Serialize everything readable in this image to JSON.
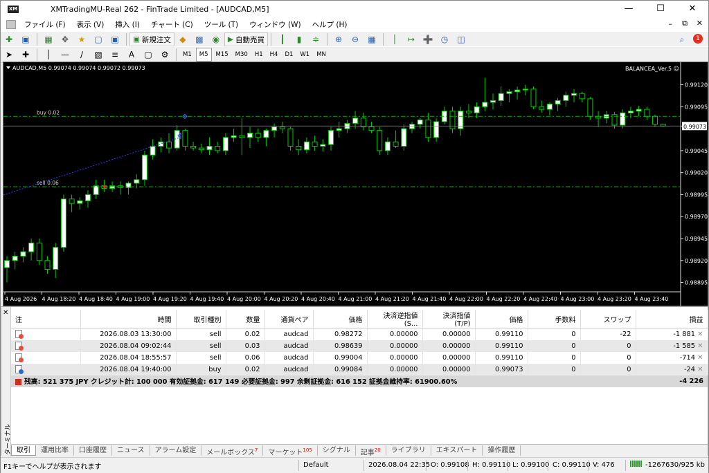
{
  "window": {
    "title": "XMTradingMU-Real 262 - FinTrade Limited - [AUDCAD,M5]",
    "icon_text": "XM"
  },
  "menu": [
    "ファイル (F)",
    "表示 (V)",
    "挿入 (I)",
    "チャート (C)",
    "ツール (T)",
    "ウィンドウ (W)",
    "ヘルプ (H)"
  ],
  "toolbar": {
    "new_order": "新規注文",
    "auto_trade": "自動売買",
    "notification_count": "1"
  },
  "timeframes": [
    "M1",
    "M5",
    "M15",
    "M30",
    "H1",
    "H4",
    "D1",
    "W1",
    "MN"
  ],
  "selected_timeframe": "M5",
  "chart": {
    "header": "AUDCAD,M5  0.99074 0.99074 0.99072 0.99073",
    "ea_label": "BALANCEA_Ver.5 ☺",
    "current_price": "0.99073",
    "price_ticks": [
      "0.99120",
      "0.99095",
      "0.99073",
      "0.99045",
      "0.99020",
      "0.98995",
      "0.98970",
      "0.98945",
      "0.98920",
      "0.98895"
    ],
    "time_labels": [
      "4 Aug 2026",
      "4 Aug 18:20",
      "4 Aug 18:40",
      "4 Aug 19:00",
      "4 Aug 19:20",
      "4 Aug 19:40",
      "4 Aug 20:00",
      "4 Aug 20:20",
      "4 Aug 20:40",
      "4 Aug 21:00",
      "4 Aug 21:20",
      "4 Aug 21:40",
      "4 Aug 22:00",
      "4 Aug 22:20",
      "4 Aug 22:40",
      "4 Aug 23:00",
      "4 Aug 23:20",
      "4 Aug 23:40"
    ],
    "order_lines": [
      {
        "label": "buy 0.02",
        "price": 0.99084
      },
      {
        "label": "sell 0.06",
        "price": 0.99004
      }
    ],
    "colors": {
      "background": "#000000",
      "bull": "#ffffff",
      "bear": "#000000",
      "wick": "#00c800",
      "grid_line": "#00b400"
    }
  },
  "chart_data": {
    "type": "candlestick",
    "symbol": "AUDCAD",
    "timeframe": "M5",
    "ylim": [
      0.98886,
      0.99133
    ],
    "candles": [
      [
        0.98912,
        0.98925,
        0.98895,
        0.9892
      ],
      [
        0.9892,
        0.9893,
        0.9891,
        0.98925
      ],
      [
        0.98925,
        0.98935,
        0.98918,
        0.9893
      ],
      [
        0.9893,
        0.98945,
        0.9892,
        0.9894
      ],
      [
        0.9894,
        0.98945,
        0.98915,
        0.9892
      ],
      [
        0.9892,
        0.98925,
        0.98905,
        0.9891
      ],
      [
        0.9891,
        0.9894,
        0.989,
        0.98935
      ],
      [
        0.98935,
        0.98995,
        0.9893,
        0.9899
      ],
      [
        0.9899,
        0.98995,
        0.98975,
        0.98985
      ],
      [
        0.98985,
        0.98992,
        0.98978,
        0.98988
      ],
      [
        0.98988,
        0.99,
        0.9898,
        0.98995
      ],
      [
        0.98995,
        0.99012,
        0.9899,
        0.99005
      ],
      [
        0.99005,
        0.99012,
        0.98998,
        0.99002
      ],
      [
        0.99002,
        0.9901,
        0.98998,
        0.99005
      ],
      [
        0.99005,
        0.9901,
        0.98995,
        0.99003
      ],
      [
        0.99003,
        0.9901,
        0.98995,
        0.99008
      ],
      [
        0.99008,
        0.99018,
        0.99002,
        0.99012
      ],
      [
        0.99012,
        0.99045,
        0.99005,
        0.9904
      ],
      [
        0.9904,
        0.99058,
        0.99035,
        0.9905
      ],
      [
        0.9905,
        0.9906,
        0.99043,
        0.99055
      ],
      [
        0.99055,
        0.99065,
        0.99042,
        0.99048
      ],
      [
        0.99048,
        0.99074,
        0.99045,
        0.99068
      ],
      [
        0.99068,
        0.9907,
        0.99045,
        0.9905
      ],
      [
        0.9905,
        0.99055,
        0.99045,
        0.99048
      ],
      [
        0.99048,
        0.99053,
        0.99042,
        0.99046
      ],
      [
        0.99046,
        0.9906,
        0.9904,
        0.9905
      ],
      [
        0.9905,
        0.99055,
        0.99042,
        0.99045
      ],
      [
        0.99045,
        0.99065,
        0.9904,
        0.9906
      ],
      [
        0.9906,
        0.9907,
        0.99055,
        0.99062
      ],
      [
        0.99062,
        0.99082,
        0.9904,
        0.9906
      ],
      [
        0.9906,
        0.99072,
        0.99048,
        0.99065
      ],
      [
        0.99065,
        0.9907,
        0.99055,
        0.9906
      ],
      [
        0.9906,
        0.9907,
        0.9905,
        0.99068
      ],
      [
        0.99068,
        0.99076,
        0.9906,
        0.99072
      ],
      [
        0.99072,
        0.99078,
        0.99065,
        0.9907
      ],
      [
        0.9907,
        0.99072,
        0.99045,
        0.9905
      ],
      [
        0.9905,
        0.99058,
        0.9904,
        0.99046
      ],
      [
        0.99046,
        0.9906,
        0.99042,
        0.99055
      ],
      [
        0.99055,
        0.99062,
        0.99045,
        0.9905
      ],
      [
        0.9905,
        0.99058,
        0.99044,
        0.99052
      ],
      [
        0.99052,
        0.99072,
        0.99045,
        0.99068
      ],
      [
        0.99068,
        0.99078,
        0.9906,
        0.9907
      ],
      [
        0.9907,
        0.9908,
        0.99065,
        0.99076
      ],
      [
        0.99076,
        0.9909,
        0.9907,
        0.99082
      ],
      [
        0.99082,
        0.99088,
        0.99068,
        0.99072
      ],
      [
        0.99072,
        0.99078,
        0.99065,
        0.99068
      ],
      [
        0.99068,
        0.99072,
        0.9904,
        0.99045
      ],
      [
        0.99045,
        0.9906,
        0.9904,
        0.99055
      ],
      [
        0.99055,
        0.99068,
        0.99048,
        0.9905
      ],
      [
        0.9905,
        0.99075,
        0.99045,
        0.9907
      ],
      [
        0.9907,
        0.99078,
        0.99065,
        0.99075
      ],
      [
        0.99075,
        0.99082,
        0.9907,
        0.9908
      ],
      [
        0.9908,
        0.99088,
        0.99055,
        0.9906
      ],
      [
        0.9906,
        0.99082,
        0.99055,
        0.99078
      ],
      [
        0.99078,
        0.99095,
        0.99075,
        0.9909
      ],
      [
        0.9909,
        0.99095,
        0.99065,
        0.9907
      ],
      [
        0.9907,
        0.99095,
        0.99062,
        0.9909
      ],
      [
        0.9909,
        0.99098,
        0.99082,
        0.99088
      ],
      [
        0.99088,
        0.991,
        0.99082,
        0.99095
      ],
      [
        0.99095,
        0.99128,
        0.9909,
        0.991
      ],
      [
        0.991,
        0.9911,
        0.99092,
        0.99102
      ],
      [
        0.99102,
        0.99118,
        0.99096,
        0.9911
      ],
      [
        0.9911,
        0.99115,
        0.991,
        0.99112
      ],
      [
        0.99112,
        0.99118,
        0.99103,
        0.99114
      ],
      [
        0.99114,
        0.9912,
        0.99108,
        0.99115
      ],
      [
        0.99115,
        0.99118,
        0.99092,
        0.99095
      ],
      [
        0.99095,
        0.99102,
        0.99088,
        0.99092
      ],
      [
        0.99092,
        0.991,
        0.99085,
        0.99098
      ],
      [
        0.99098,
        0.99105,
        0.9909,
        0.99102
      ],
      [
        0.99102,
        0.99112,
        0.99095,
        0.99108
      ],
      [
        0.99108,
        0.99115,
        0.991,
        0.9911
      ],
      [
        0.9911,
        0.99112,
        0.991,
        0.99104
      ],
      [
        0.99104,
        0.99106,
        0.9908,
        0.99084
      ],
      [
        0.99084,
        0.9909,
        0.99072,
        0.99082
      ],
      [
        0.99082,
        0.9909,
        0.99076,
        0.99086
      ],
      [
        0.99086,
        0.99089,
        0.9907,
        0.99074
      ],
      [
        0.99074,
        0.99092,
        0.9907,
        0.99088
      ],
      [
        0.99088,
        0.99095,
        0.99082,
        0.9909
      ],
      [
        0.9909,
        0.99096,
        0.99084,
        0.99092
      ],
      [
        0.99092,
        0.99095,
        0.9908,
        0.99084
      ],
      [
        0.99084,
        0.99086,
        0.99072,
        0.99075
      ],
      [
        0.99075,
        0.99076,
        0.99072,
        0.99073
      ]
    ]
  },
  "terminal": {
    "side_label": "ターミナル",
    "columns": [
      "注",
      "時間",
      "取引種別",
      "数量",
      "通貨ペア",
      "価格",
      "決済逆指値(S...",
      "決済指値(T/P)",
      "価格",
      "手数料",
      "スワップ",
      "損益"
    ],
    "rows": [
      {
        "time": "2026.08.03 13:30:00",
        "type": "sell",
        "volume": "0.02",
        "symbol": "audcad",
        "price": "0.98272",
        "sl": "0.00000",
        "tp": "0.00000",
        "cur": "0.99110",
        "commission": "0",
        "swap": "-22",
        "profit": "-1 881"
      },
      {
        "time": "2026.08.04 09:02:44",
        "type": "sell",
        "volume": "0.03",
        "symbol": "audcad",
        "price": "0.98639",
        "sl": "0.00000",
        "tp": "0.00000",
        "cur": "0.99110",
        "commission": "0",
        "swap": "0",
        "profit": "-1 585"
      },
      {
        "time": "2026.08.04 18:55:57",
        "type": "sell",
        "volume": "0.06",
        "symbol": "audcad",
        "price": "0.99004",
        "sl": "0.00000",
        "tp": "0.00000",
        "cur": "0.99110",
        "commission": "0",
        "swap": "0",
        "profit": "-714"
      },
      {
        "time": "2026.08.04 19:40:00",
        "type": "buy",
        "volume": "0.02",
        "symbol": "audcad",
        "price": "0.99084",
        "sl": "0.00000",
        "tp": "0.00000",
        "cur": "0.99073",
        "commission": "0",
        "swap": "0",
        "profit": "-24"
      }
    ],
    "summary": "残高: 521 375 JPY  クレジット計: 100 000  有効証拠金: 617 149  必要証拠金: 997  余剰証拠金: 616 152  証拠金維持率: 61900.60%",
    "summary_profit": "-4 226",
    "tabs": [
      {
        "label": "取引",
        "badge": ""
      },
      {
        "label": "運用比率",
        "badge": ""
      },
      {
        "label": "口座履歴",
        "badge": ""
      },
      {
        "label": "ニュース",
        "badge": ""
      },
      {
        "label": "アラーム設定",
        "badge": ""
      },
      {
        "label": "メールボックス",
        "badge": "7"
      },
      {
        "label": "マーケット",
        "badge": "105"
      },
      {
        "label": "シグナル",
        "badge": ""
      },
      {
        "label": "記事",
        "badge": "20"
      },
      {
        "label": "ライブラリ",
        "badge": ""
      },
      {
        "label": "エキスパート",
        "badge": ""
      },
      {
        "label": "操作履歴",
        "badge": ""
      }
    ]
  },
  "statusbar": {
    "help": "F1キーでヘルプが表示されます",
    "profile": "Default",
    "datetime": "2026.08.04 22:35",
    "open": "O: 0.99108",
    "high": "H: 0.99110",
    "low": "L: 0.99100",
    "close": "C: 0.99110",
    "volume": "V: 476",
    "traffic": "-1267630/925 kb"
  }
}
